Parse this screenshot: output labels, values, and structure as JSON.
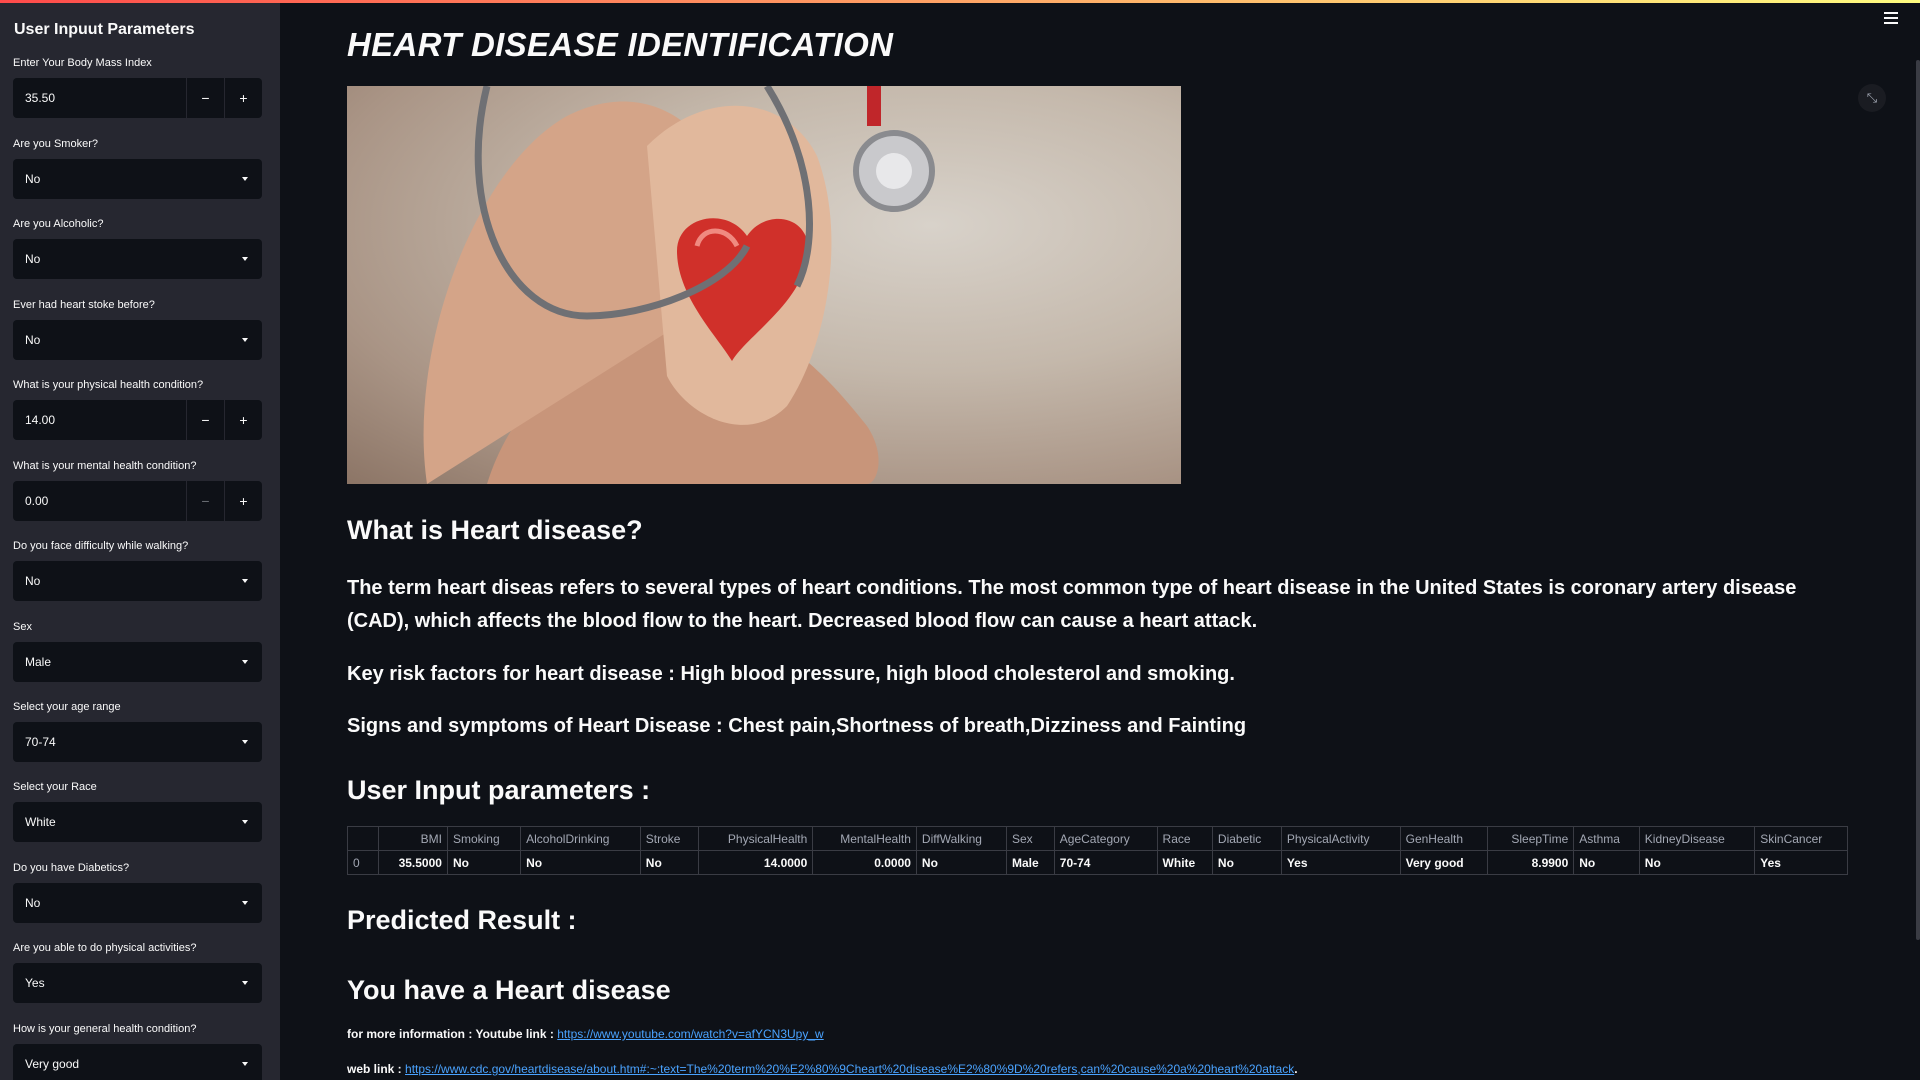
{
  "sidebar": {
    "title": "User Inpuut Parameters",
    "fields": [
      {
        "label": "Enter Your Body Mass Index",
        "type": "number",
        "value": "35.50"
      },
      {
        "label": "Are you Smoker?",
        "type": "select",
        "value": "No"
      },
      {
        "label": "Are you Alcoholic?",
        "type": "select",
        "value": "No"
      },
      {
        "label": "Ever had heart stoke before?",
        "type": "select",
        "value": "No"
      },
      {
        "label": "What is your physical health condition?",
        "type": "number",
        "value": "14.00"
      },
      {
        "label": "What is your mental health condition?",
        "type": "number",
        "value": "0.00"
      },
      {
        "label": "Do you face difficulty while walking?",
        "type": "select",
        "value": "No"
      },
      {
        "label": "Sex",
        "type": "select",
        "value": "Male"
      },
      {
        "label": "Select your age range",
        "type": "select",
        "value": "70-74"
      },
      {
        "label": "Select your Race",
        "type": "select",
        "value": "White"
      },
      {
        "label": "Do you have Diabetics?",
        "type": "select",
        "value": "No"
      },
      {
        "label": "Are you able to do physical activities?",
        "type": "select",
        "value": "Yes"
      },
      {
        "label": "How is your general health condition?",
        "type": "select",
        "value": "Very good"
      }
    ],
    "minus": "−",
    "plus": "+"
  },
  "main": {
    "title": "HEART DISEASE IDENTIFICATION",
    "what_heading": "What is Heart disease?",
    "para1": "The term heart diseas refers to several types of heart conditions. The most common type of heart disease in the United States is coronary artery disease (CAD), which affects the blood flow to the heart. Decreased blood flow can cause a heart attack.",
    "para2": "Key risk factors for heart disease : High blood pressure, high blood cholesterol and smoking.",
    "para3": "Signs and symptoms of Heart Disease : Chest pain,Shortness of breath,Dizziness and Fainting",
    "params_heading": "User Input parameters :",
    "table": {
      "headers": [
        "",
        "BMI",
        "Smoking",
        "AlcoholDrinking",
        "Stroke",
        "PhysicalHealth",
        "MentalHealth",
        "DiffWalking",
        "Sex",
        "AgeCategory",
        "Race",
        "Diabetic",
        "PhysicalActivity",
        "GenHealth",
        "SleepTime",
        "Asthma",
        "KidneyDisease",
        "SkinCancer"
      ],
      "row": [
        "0",
        "35.5000",
        "No",
        "No",
        "No",
        "14.0000",
        "0.0000",
        "No",
        "Male",
        "70-74",
        "White",
        "No",
        "Yes",
        "Very good",
        "8.9900",
        "No",
        "No",
        "Yes"
      ]
    },
    "predicted_heading": "Predicted Result :",
    "result": "You have a Heart disease",
    "youtube_label": "for more information : Youtube link : ",
    "youtube_url": "https://www.youtube.com/watch?v=afYCN3Upy_w",
    "web_label": "web link : ",
    "web_url": "https://www.cdc.gov/heartdisease/about.htm#:~:text=The%20term%20%E2%80%9Cheart%20disease%E2%80%9D%20refers,can%20cause%20a%20heart%20attack",
    "web_trail": "."
  },
  "icons": {
    "menu": "hamburger-menu-icon",
    "expand": "fullscreen-expand-icon",
    "caret": "caret-down-icon"
  }
}
